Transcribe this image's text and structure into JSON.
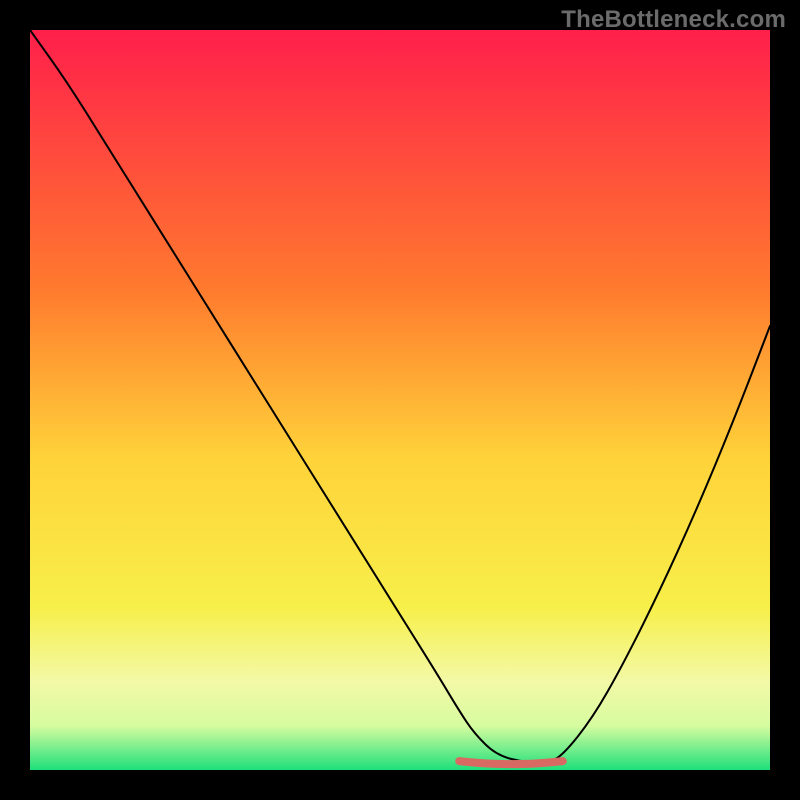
{
  "watermark": "TheBottleneck.com",
  "chart_data": {
    "type": "line",
    "title": "",
    "xlabel": "",
    "ylabel": "",
    "xlim": [
      0,
      100
    ],
    "ylim": [
      0,
      100
    ],
    "grid": false,
    "legend": false,
    "background_gradient_stops": [
      {
        "offset": 0,
        "color": "#ff1f4b"
      },
      {
        "offset": 35,
        "color": "#ff7a2e"
      },
      {
        "offset": 58,
        "color": "#ffd33a"
      },
      {
        "offset": 78,
        "color": "#f7ef4a"
      },
      {
        "offset": 88,
        "color": "#f3f9a6"
      },
      {
        "offset": 94,
        "color": "#d7fca0"
      },
      {
        "offset": 100,
        "color": "#1ee07a"
      }
    ],
    "series": [
      {
        "name": "bottleneck-curve",
        "color": "#000000",
        "stroke_width": 2,
        "x": [
          0,
          5,
          10,
          15,
          20,
          25,
          30,
          35,
          40,
          45,
          50,
          55,
          58,
          60,
          63,
          67,
          70,
          72,
          76,
          80,
          85,
          90,
          95,
          100
        ],
        "values": [
          100,
          93,
          85,
          77,
          69,
          61,
          53,
          45,
          37,
          29,
          21,
          13,
          8,
          5,
          2,
          1,
          1,
          2,
          7,
          14,
          24,
          35,
          47,
          60
        ]
      },
      {
        "name": "optimal-zone",
        "color": "#d86a63",
        "stroke_width": 8,
        "x": [
          58,
          60,
          63,
          67,
          70,
          72
        ],
        "values": [
          1.2,
          1.0,
          0.8,
          0.8,
          1.0,
          1.2
        ]
      }
    ]
  }
}
